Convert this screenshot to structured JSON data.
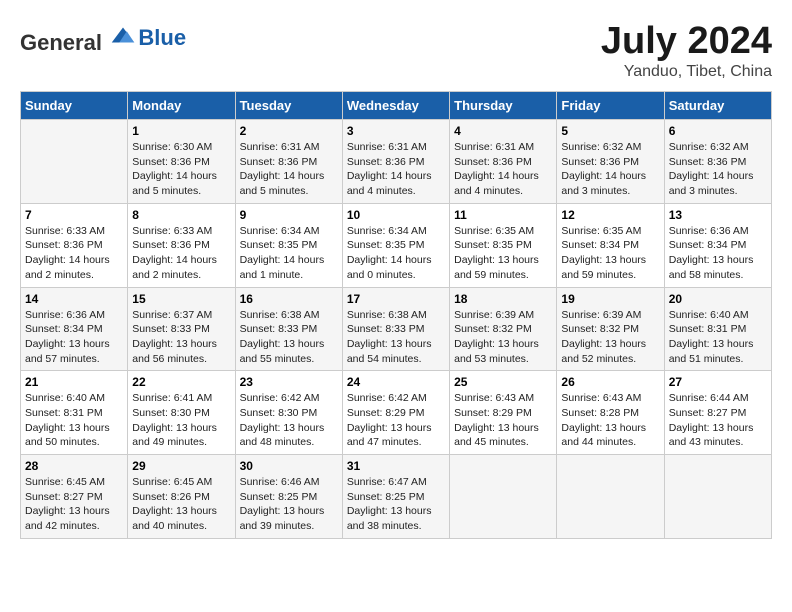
{
  "logo": {
    "general": "General",
    "blue": "Blue"
  },
  "title": "July 2024",
  "subtitle": "Yanduo, Tibet, China",
  "headers": [
    "Sunday",
    "Monday",
    "Tuesday",
    "Wednesday",
    "Thursday",
    "Friday",
    "Saturday"
  ],
  "weeks": [
    [
      {
        "day": "",
        "sunrise": "",
        "sunset": "",
        "daylight": ""
      },
      {
        "day": "1",
        "sunrise": "Sunrise: 6:30 AM",
        "sunset": "Sunset: 8:36 PM",
        "daylight": "Daylight: 14 hours and 5 minutes."
      },
      {
        "day": "2",
        "sunrise": "Sunrise: 6:31 AM",
        "sunset": "Sunset: 8:36 PM",
        "daylight": "Daylight: 14 hours and 5 minutes."
      },
      {
        "day": "3",
        "sunrise": "Sunrise: 6:31 AM",
        "sunset": "Sunset: 8:36 PM",
        "daylight": "Daylight: 14 hours and 4 minutes."
      },
      {
        "day": "4",
        "sunrise": "Sunrise: 6:31 AM",
        "sunset": "Sunset: 8:36 PM",
        "daylight": "Daylight: 14 hours and 4 minutes."
      },
      {
        "day": "5",
        "sunrise": "Sunrise: 6:32 AM",
        "sunset": "Sunset: 8:36 PM",
        "daylight": "Daylight: 14 hours and 3 minutes."
      },
      {
        "day": "6",
        "sunrise": "Sunrise: 6:32 AM",
        "sunset": "Sunset: 8:36 PM",
        "daylight": "Daylight: 14 hours and 3 minutes."
      }
    ],
    [
      {
        "day": "7",
        "sunrise": "Sunrise: 6:33 AM",
        "sunset": "Sunset: 8:36 PM",
        "daylight": "Daylight: 14 hours and 2 minutes."
      },
      {
        "day": "8",
        "sunrise": "Sunrise: 6:33 AM",
        "sunset": "Sunset: 8:36 PM",
        "daylight": "Daylight: 14 hours and 2 minutes."
      },
      {
        "day": "9",
        "sunrise": "Sunrise: 6:34 AM",
        "sunset": "Sunset: 8:35 PM",
        "daylight": "Daylight: 14 hours and 1 minute."
      },
      {
        "day": "10",
        "sunrise": "Sunrise: 6:34 AM",
        "sunset": "Sunset: 8:35 PM",
        "daylight": "Daylight: 14 hours and 0 minutes."
      },
      {
        "day": "11",
        "sunrise": "Sunrise: 6:35 AM",
        "sunset": "Sunset: 8:35 PM",
        "daylight": "Daylight: 13 hours and 59 minutes."
      },
      {
        "day": "12",
        "sunrise": "Sunrise: 6:35 AM",
        "sunset": "Sunset: 8:34 PM",
        "daylight": "Daylight: 13 hours and 59 minutes."
      },
      {
        "day": "13",
        "sunrise": "Sunrise: 6:36 AM",
        "sunset": "Sunset: 8:34 PM",
        "daylight": "Daylight: 13 hours and 58 minutes."
      }
    ],
    [
      {
        "day": "14",
        "sunrise": "Sunrise: 6:36 AM",
        "sunset": "Sunset: 8:34 PM",
        "daylight": "Daylight: 13 hours and 57 minutes."
      },
      {
        "day": "15",
        "sunrise": "Sunrise: 6:37 AM",
        "sunset": "Sunset: 8:33 PM",
        "daylight": "Daylight: 13 hours and 56 minutes."
      },
      {
        "day": "16",
        "sunrise": "Sunrise: 6:38 AM",
        "sunset": "Sunset: 8:33 PM",
        "daylight": "Daylight: 13 hours and 55 minutes."
      },
      {
        "day": "17",
        "sunrise": "Sunrise: 6:38 AM",
        "sunset": "Sunset: 8:33 PM",
        "daylight": "Daylight: 13 hours and 54 minutes."
      },
      {
        "day": "18",
        "sunrise": "Sunrise: 6:39 AM",
        "sunset": "Sunset: 8:32 PM",
        "daylight": "Daylight: 13 hours and 53 minutes."
      },
      {
        "day": "19",
        "sunrise": "Sunrise: 6:39 AM",
        "sunset": "Sunset: 8:32 PM",
        "daylight": "Daylight: 13 hours and 52 minutes."
      },
      {
        "day": "20",
        "sunrise": "Sunrise: 6:40 AM",
        "sunset": "Sunset: 8:31 PM",
        "daylight": "Daylight: 13 hours and 51 minutes."
      }
    ],
    [
      {
        "day": "21",
        "sunrise": "Sunrise: 6:40 AM",
        "sunset": "Sunset: 8:31 PM",
        "daylight": "Daylight: 13 hours and 50 minutes."
      },
      {
        "day": "22",
        "sunrise": "Sunrise: 6:41 AM",
        "sunset": "Sunset: 8:30 PM",
        "daylight": "Daylight: 13 hours and 49 minutes."
      },
      {
        "day": "23",
        "sunrise": "Sunrise: 6:42 AM",
        "sunset": "Sunset: 8:30 PM",
        "daylight": "Daylight: 13 hours and 48 minutes."
      },
      {
        "day": "24",
        "sunrise": "Sunrise: 6:42 AM",
        "sunset": "Sunset: 8:29 PM",
        "daylight": "Daylight: 13 hours and 47 minutes."
      },
      {
        "day": "25",
        "sunrise": "Sunrise: 6:43 AM",
        "sunset": "Sunset: 8:29 PM",
        "daylight": "Daylight: 13 hours and 45 minutes."
      },
      {
        "day": "26",
        "sunrise": "Sunrise: 6:43 AM",
        "sunset": "Sunset: 8:28 PM",
        "daylight": "Daylight: 13 hours and 44 minutes."
      },
      {
        "day": "27",
        "sunrise": "Sunrise: 6:44 AM",
        "sunset": "Sunset: 8:27 PM",
        "daylight": "Daylight: 13 hours and 43 minutes."
      }
    ],
    [
      {
        "day": "28",
        "sunrise": "Sunrise: 6:45 AM",
        "sunset": "Sunset: 8:27 PM",
        "daylight": "Daylight: 13 hours and 42 minutes."
      },
      {
        "day": "29",
        "sunrise": "Sunrise: 6:45 AM",
        "sunset": "Sunset: 8:26 PM",
        "daylight": "Daylight: 13 hours and 40 minutes."
      },
      {
        "day": "30",
        "sunrise": "Sunrise: 6:46 AM",
        "sunset": "Sunset: 8:25 PM",
        "daylight": "Daylight: 13 hours and 39 minutes."
      },
      {
        "day": "31",
        "sunrise": "Sunrise: 6:47 AM",
        "sunset": "Sunset: 8:25 PM",
        "daylight": "Daylight: 13 hours and 38 minutes."
      },
      {
        "day": "",
        "sunrise": "",
        "sunset": "",
        "daylight": ""
      },
      {
        "day": "",
        "sunrise": "",
        "sunset": "",
        "daylight": ""
      },
      {
        "day": "",
        "sunrise": "",
        "sunset": "",
        "daylight": ""
      }
    ]
  ]
}
